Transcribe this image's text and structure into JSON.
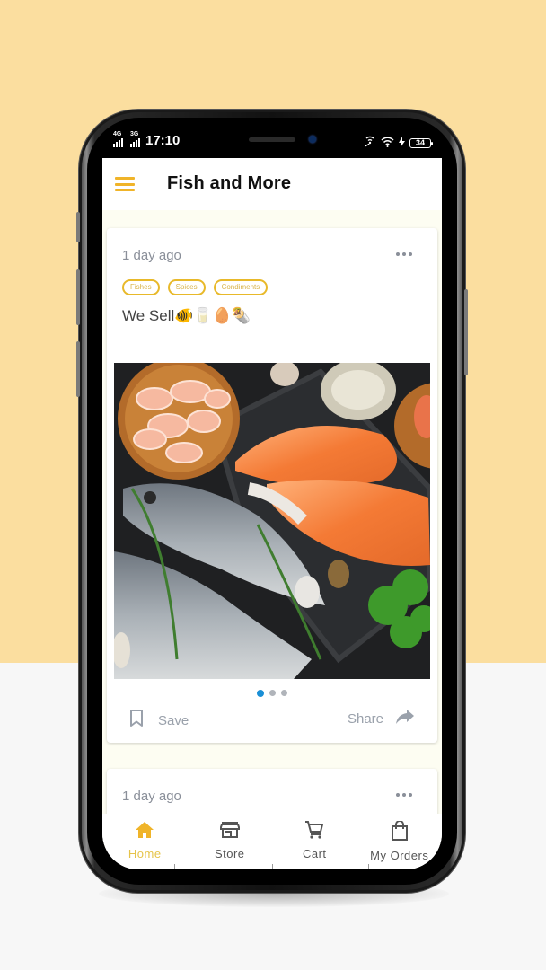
{
  "statusbar": {
    "network1": "4G",
    "network2": "3G",
    "time": "17:10",
    "battery": "34"
  },
  "appbar": {
    "title": "Fish and More",
    "menu_icon": "hamburger-menu-icon"
  },
  "posts": [
    {
      "time_ago": "1 day ago",
      "tags": [
        "Fishes",
        "Spices",
        "Condiments"
      ],
      "text": "We Sell🐠🥛🥚🌯",
      "image_alt": "Assorted seafood: shrimp, salmon steaks, whole fish, oysters, herbs",
      "carousel": {
        "count": 3,
        "active_index": 0
      },
      "save_label": "Save",
      "share_label": "Share"
    },
    {
      "time_ago": "1 day ago"
    }
  ],
  "bottom_nav": {
    "active": "Home",
    "items": [
      {
        "label": "Home",
        "icon": "home-icon"
      },
      {
        "label": "Store",
        "icon": "store-icon"
      },
      {
        "label": "Cart",
        "icon": "cart-icon"
      },
      {
        "label": "My Orders",
        "icon": "shopping-bag-icon"
      }
    ]
  },
  "colors": {
    "accent": "#f0b429",
    "tag_border": "#e8b92a",
    "carousel_active": "#1a8fd6",
    "background_top": "#fbde9f",
    "background_bottom": "#f7f7f7",
    "screen_bg": "#fdfdf2"
  }
}
